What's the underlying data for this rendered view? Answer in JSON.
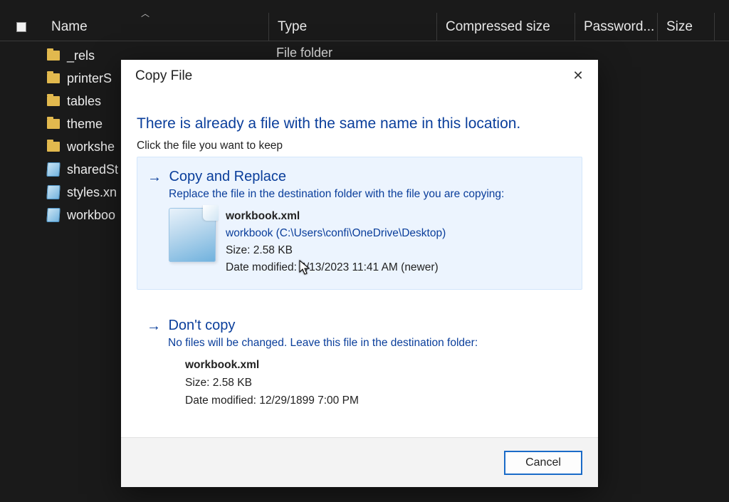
{
  "columns": {
    "name": "Name",
    "type": "Type",
    "compressed": "Compressed size",
    "password": "Password...",
    "size": "Size"
  },
  "filelist": [
    {
      "icon": "folder",
      "name": "_rels"
    },
    {
      "icon": "folder",
      "name": "printerS"
    },
    {
      "icon": "folder",
      "name": "tables"
    },
    {
      "icon": "folder",
      "name": "theme"
    },
    {
      "icon": "folder",
      "name": "workshe"
    },
    {
      "icon": "xml",
      "name": "sharedSt"
    },
    {
      "icon": "xml",
      "name": "styles.xn"
    },
    {
      "icon": "xml",
      "name": "workboo"
    }
  ],
  "bg_type_cell": "File folder",
  "dialog": {
    "title": "Copy File",
    "headline": "There is already a file with the same name in this location.",
    "subtext": "Click the file you want to keep",
    "option1": {
      "title": "Copy and Replace",
      "desc": "Replace the file in the destination folder with the file you are copying:",
      "file": {
        "name": "workbook.xml",
        "path": "workbook (C:\\Users\\confi\\OneDrive\\Desktop)",
        "size": "Size: 2.58 KB",
        "date": "Date modified: 4/13/2023 11:41 AM (newer)"
      }
    },
    "option2": {
      "title": "Don't copy",
      "desc": "No files will be changed. Leave this file in the destination folder:",
      "file": {
        "name": "workbook.xml",
        "size": "Size: 2.58 KB",
        "date": "Date modified: 12/29/1899 7:00 PM"
      }
    },
    "cancel": "Cancel"
  }
}
